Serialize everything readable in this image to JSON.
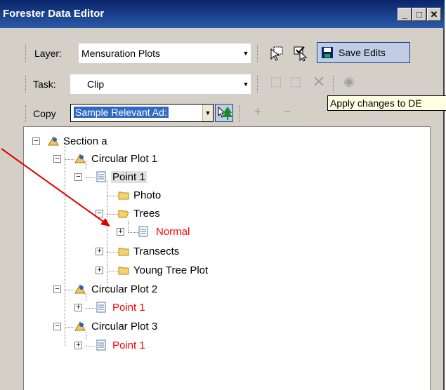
{
  "window": {
    "title": "Forester Data Editor"
  },
  "toolbar": {
    "layer_label": "Layer:",
    "layer_value": "Mensuration Plots",
    "save_edits_label": "Save Edits",
    "task_label": "Task:",
    "task_value": "Clip",
    "copy_label": "Copy",
    "copy_value": "Sample Relevant Ad:",
    "plus_label": "+",
    "minus_label": "−"
  },
  "tooltip": {
    "text": "Apply changes to DE"
  },
  "tree": {
    "section": "Section a",
    "plot1": "Circular Plot 1",
    "point1": "Point 1",
    "photo": "Photo",
    "trees": "Trees",
    "normal": "Normal",
    "transects": "Transects",
    "young_tree_plot": "Young Tree Plot",
    "plot2": "Circular Plot 2",
    "plot2_point": "Point 1",
    "plot3": "Circular Plot 3",
    "plot3_point": "Point 1"
  },
  "colors": {
    "title_bar": "#0a246a",
    "highlight": "#ff0000",
    "selection": "#316ac5"
  }
}
